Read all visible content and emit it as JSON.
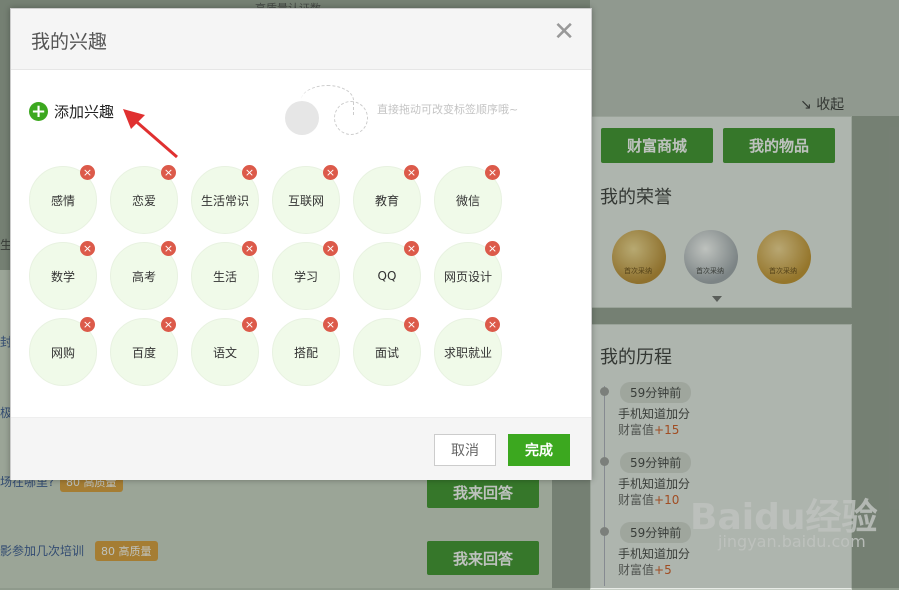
{
  "modal": {
    "title": "我的兴趣",
    "add_label": "添加兴趣",
    "drag_hint": "直接拖动可改变标签顺序哦~",
    "cancel_label": "取消",
    "done_label": "完成",
    "delete_symbol": "×",
    "tags": [
      "感情",
      "恋爱",
      "生活常识",
      "互联网",
      "教育",
      "微信",
      "数学",
      "高考",
      "生活",
      "学习",
      "QQ",
      "网页设计",
      "网购",
      "百度",
      "语文",
      "搭配",
      "面试",
      "求职就业"
    ]
  },
  "background": {
    "top_text": "高质量认证数",
    "collapse_label": "收起",
    "mall_button": "财富商城",
    "items_button": "我的物品",
    "honor_title": "我的荣誉",
    "medal_text": "首次采纳",
    "history_title": "我的历程",
    "history": [
      {
        "time": "59分钟前",
        "text": "手机知道加分",
        "value_label": "财富值",
        "value": "+15"
      },
      {
        "time": "59分钟前",
        "text": "手机知道加分",
        "value_label": "财富值",
        "value": "+10"
      },
      {
        "time": "59分钟前",
        "text": "手机知道加分",
        "value_label": "财富值",
        "value": "+5"
      }
    ],
    "answer_button": "我来回答",
    "question1_text": "场在哪里?",
    "question2_text": "影参加几次培训",
    "badge": "80 高质量",
    "frag_a": "生",
    "frag_b": "封",
    "frag_c": "极"
  },
  "watermark": {
    "brand": "Baidu经验",
    "url": "jingyan.baidu.com"
  },
  "colors": {
    "accent_green": "#3ca81f",
    "delete_red": "#dc5a4a",
    "tag_bg": "#f0fae9",
    "value_orange": "#d24c12"
  }
}
